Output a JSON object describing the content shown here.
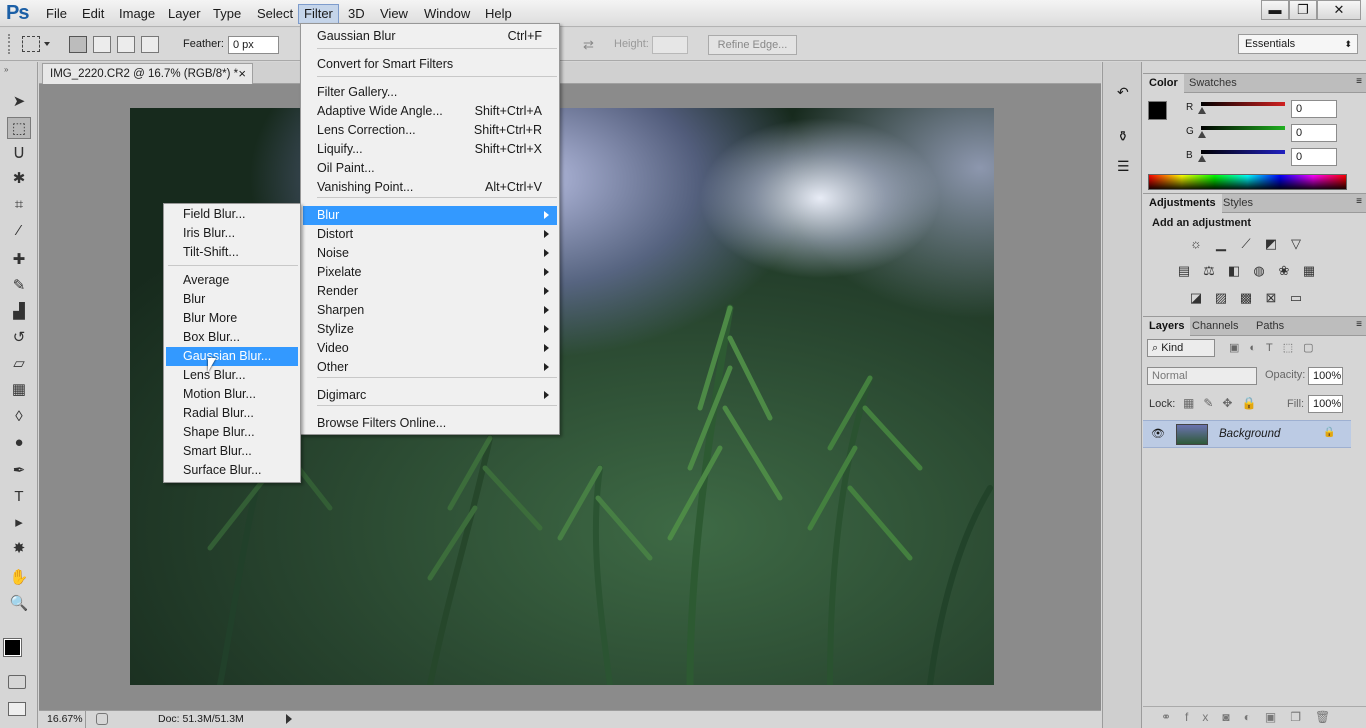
{
  "app": {
    "logo": "Ps"
  },
  "menubar": {
    "items": [
      "File",
      "Edit",
      "Image",
      "Layer",
      "Type",
      "Select",
      "Filter",
      "3D",
      "View",
      "Window",
      "Help"
    ],
    "open_item": "Filter",
    "window_controls": {
      "minimize": "▬",
      "restore": "❐",
      "close": "✕"
    }
  },
  "options_bar": {
    "feather_label": "Feather:",
    "feather_value": "0 px",
    "height_label": "Height:",
    "refine_edge_label": "Refine Edge...",
    "workspace": "Essentials"
  },
  "document": {
    "tab_title": "IMG_2220.CR2 @ 16.7% (RGB/8*) *",
    "tab_close": "×",
    "zoom": "16.67%",
    "doc_info": "Doc: 51.3M/51.3M"
  },
  "tools": [
    {
      "name": "move-tool",
      "glyph": "➤"
    },
    {
      "name": "rectangular-marquee-tool",
      "glyph": "⬚"
    },
    {
      "name": "lasso-tool",
      "glyph": "ᑌ"
    },
    {
      "name": "quick-selection-tool",
      "glyph": "✱"
    },
    {
      "name": "crop-tool",
      "glyph": "⌗"
    },
    {
      "name": "eyedropper-tool",
      "glyph": "⁄"
    },
    {
      "name": "spot-healing-tool",
      "glyph": "✚"
    },
    {
      "name": "brush-tool",
      "glyph": "✎"
    },
    {
      "name": "clone-stamp-tool",
      "glyph": "▟"
    },
    {
      "name": "history-brush-tool",
      "glyph": "↺"
    },
    {
      "name": "eraser-tool",
      "glyph": "▱"
    },
    {
      "name": "gradient-tool",
      "glyph": "▦"
    },
    {
      "name": "blur-tool",
      "glyph": "◊"
    },
    {
      "name": "dodge-tool",
      "glyph": "●"
    },
    {
      "name": "pen-tool",
      "glyph": "✒"
    },
    {
      "name": "type-tool",
      "glyph": "T"
    },
    {
      "name": "path-selection-tool",
      "glyph": "▸"
    },
    {
      "name": "custom-shape-tool",
      "glyph": "✸"
    },
    {
      "name": "hand-tool",
      "glyph": "✋"
    },
    {
      "name": "zoom-tool",
      "glyph": "🔍"
    }
  ],
  "filter_menu": {
    "items": [
      {
        "label": "Gaussian Blur",
        "shortcut": "Ctrl+F"
      },
      {
        "label": "Convert for Smart Filters",
        "shortcut": ""
      },
      {
        "label": "Filter Gallery...",
        "shortcut": ""
      },
      {
        "label": "Adaptive Wide Angle...",
        "shortcut": "Shift+Ctrl+A"
      },
      {
        "label": "Lens Correction...",
        "shortcut": "Shift+Ctrl+R"
      },
      {
        "label": "Liquify...",
        "shortcut": "Shift+Ctrl+X"
      },
      {
        "label": "Oil Paint...",
        "shortcut": ""
      },
      {
        "label": "Vanishing Point...",
        "shortcut": "Alt+Ctrl+V"
      },
      {
        "label": "Blur",
        "shortcut": ""
      },
      {
        "label": "Distort",
        "shortcut": ""
      },
      {
        "label": "Noise",
        "shortcut": ""
      },
      {
        "label": "Pixelate",
        "shortcut": ""
      },
      {
        "label": "Render",
        "shortcut": ""
      },
      {
        "label": "Sharpen",
        "shortcut": ""
      },
      {
        "label": "Stylize",
        "shortcut": ""
      },
      {
        "label": "Video",
        "shortcut": ""
      },
      {
        "label": "Other",
        "shortcut": ""
      },
      {
        "label": "Digimarc",
        "shortcut": ""
      },
      {
        "label": "Browse Filters Online...",
        "shortcut": ""
      }
    ]
  },
  "blur_submenu": {
    "items": [
      "Field Blur...",
      "Iris Blur...",
      "Tilt-Shift...",
      "Average",
      "Blur",
      "Blur More",
      "Box Blur...",
      "Gaussian Blur...",
      "Lens Blur...",
      "Motion Blur...",
      "Radial Blur...",
      "Shape Blur...",
      "Smart Blur...",
      "Surface Blur..."
    ],
    "highlighted": "Gaussian Blur..."
  },
  "color_panel": {
    "tabs": [
      "Color",
      "Swatches"
    ],
    "channels": [
      {
        "label": "R",
        "value": "0",
        "color": "#d02020"
      },
      {
        "label": "G",
        "value": "0",
        "color": "#20b020"
      },
      {
        "label": "B",
        "value": "0",
        "color": "#2020c0"
      }
    ]
  },
  "adjustments_panel": {
    "tabs": [
      "Adjustments",
      "Styles"
    ],
    "heading": "Add an adjustment"
  },
  "layers_panel": {
    "tabs": [
      "Layers",
      "Channels",
      "Paths"
    ],
    "kind_filter": "Kind",
    "blend_mode": "Normal",
    "opacity_label": "Opacity:",
    "opacity_value": "100%",
    "lock_label": "Lock:",
    "fill_label": "Fill:",
    "fill_value": "100%",
    "layers": [
      {
        "name": "Background",
        "visible": true,
        "locked": true
      }
    ]
  }
}
